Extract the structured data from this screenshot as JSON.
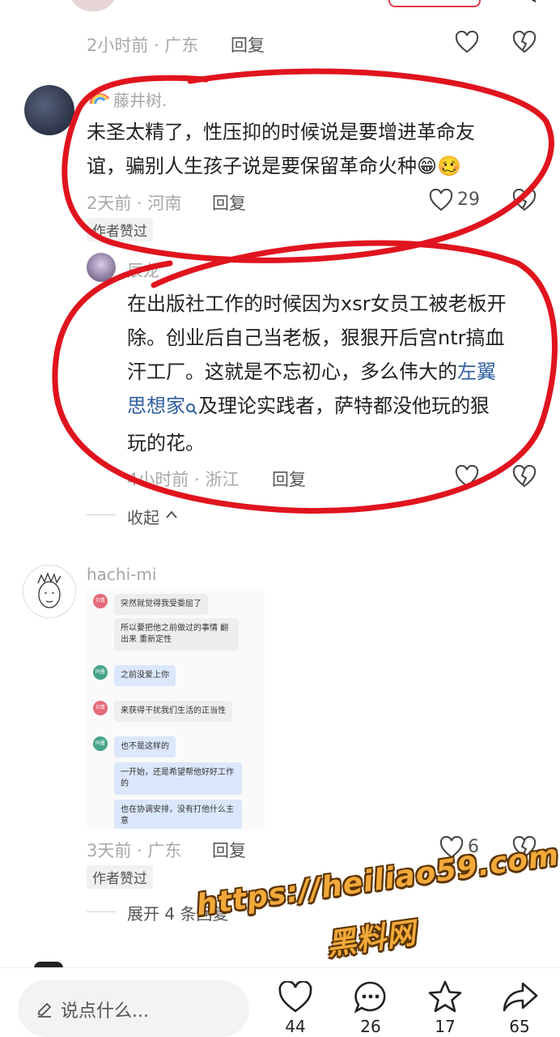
{
  "comments": [
    {
      "meta": "2小时前 · 广东",
      "reply": "回复"
    },
    {
      "username": "藤井树.",
      "text_lines": [
        "未圣太精了，性压抑的时候说是要增进革命友",
        "谊，骗别人生孩子说是要保留革命火种😁🥴"
      ],
      "meta": "2天前 · 河南",
      "reply": "回复",
      "likes": "29",
      "badge": "作者赞过"
    },
    {
      "username": "辰龙",
      "text_lines": [
        "在出版社工作的时候因为xsr女员工被老板开",
        "除。创业后自己当老板，狠狠开后宫ntr搞血",
        "汗工厂。这就是不忘初心，多么伟大的"
      ],
      "link_text": "左翼",
      "link_text2": "思想家",
      "text_after_link": "及理论实践者，萨特都没他玩的狠",
      "text_last": "玩的花。",
      "meta": "4小时前 · 浙江",
      "reply": "回复"
    },
    {
      "collapse": "收起"
    },
    {
      "username": "hachi-mi",
      "chat": [
        {
          "who": "刘青",
          "text": "突然就觉得我受委屈了",
          "blue": false
        },
        {
          "who": "",
          "text": "所以要把他之前做过的事情 翻出来 重新定性",
          "blue": false
        },
        {
          "who": "同墨",
          "text": "之前没爱上你",
          "blue": true
        },
        {
          "who": "刘青",
          "text": "来获得干扰我们生活的正当性",
          "blue": false
        },
        {
          "who": "同墨",
          "text": "也不是这样的",
          "blue": true
        },
        {
          "who": "",
          "text": "一开始，还是希望帮他好好工作的",
          "blue": true
        },
        {
          "who": "",
          "text": "也在协调安排，没有打他什么主意",
          "blue": true
        }
      ],
      "meta": "3天前 · 广东",
      "reply": "回复",
      "likes": "6",
      "badge": "作者赞过",
      "expand": "展开 4 条回复"
    }
  ],
  "bottom_bar": {
    "input_placeholder": "说点什么...",
    "likes": "44",
    "comments": "26",
    "favorites": "17",
    "shares": "65"
  },
  "watermark": {
    "line1": "https://heiliao59.com",
    "line2": "黑料网"
  },
  "colors": {
    "annotation_red": "#e0141e",
    "link_blue": "#2f5fa0",
    "watermark_orange": "#f2a93a"
  }
}
